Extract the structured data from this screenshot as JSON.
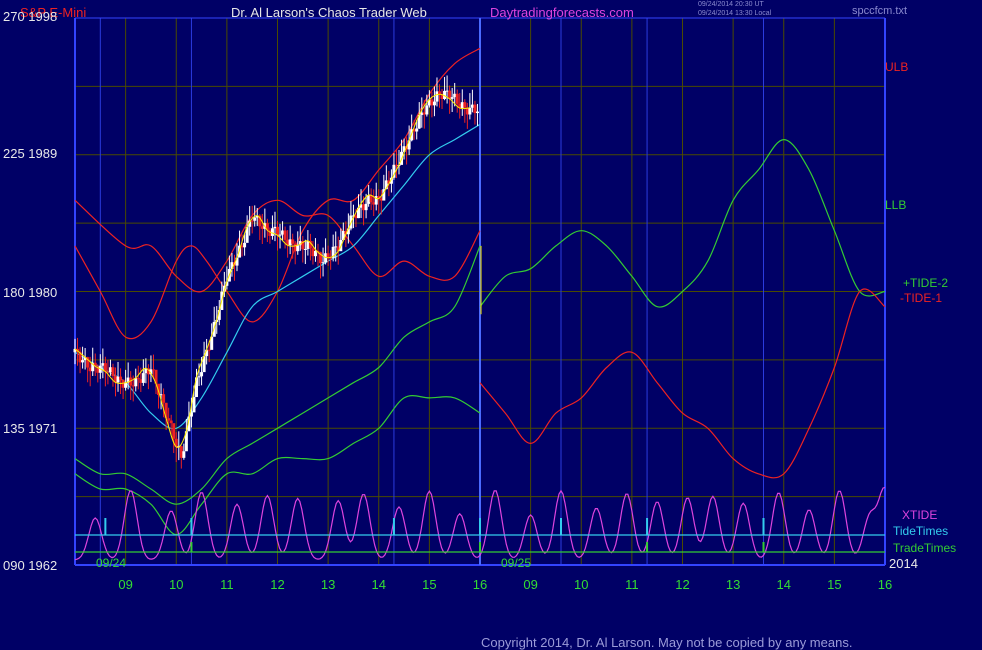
{
  "header": {
    "instrument": "S&P E-Mini",
    "site_title": "Dr. Al Larson's Chaos Trader Web",
    "url": "Daytradingforecasts.com",
    "update_line1": "09/24/2014 20:30 UT",
    "update_line2": "09/24/2014 13:30 Local",
    "filename": "spccfcm.txt"
  },
  "y_labels": [
    {
      "text": "270  1998"
    },
    {
      "text": "225  1989"
    },
    {
      "text": "180  1980"
    },
    {
      "text": "135  1971"
    },
    {
      "text": "090  1962"
    }
  ],
  "right_labels": {
    "ulb": "ULB",
    "llb": "LLB",
    "tide2": "+TIDE-2",
    "tide1": "-TIDE-1",
    "xtide": "XTIDE",
    "tidetimes": "TideTimes",
    "tradetimes": "TradeTimes",
    "year": "2014"
  },
  "date_labels": {
    "d1": "09/24",
    "d2": "09/25"
  },
  "x_hours": [
    "09",
    "10",
    "11",
    "12",
    "13",
    "14",
    "15",
    "16",
    "09",
    "10",
    "11",
    "12",
    "13",
    "14",
    "15",
    "16"
  ],
  "colors": {
    "background": "#000066",
    "frame": "#3344ff",
    "grid": "#4a4a00",
    "red": "#ee2222",
    "green": "#33cc33",
    "cyan": "#33ccee",
    "magenta": "#dd44dd",
    "white": "#ffffff",
    "yellow": "#ffee00"
  },
  "copyright": "Copyright 2014, Dr. Al Larson. May not be copied by any means.",
  "chart_data": {
    "type": "line",
    "title": "S&P E-Mini",
    "x_unit": "hour (two sessions, 09/24 and 09/25)",
    "ylim_price": [
      1962,
      1998
    ],
    "ylim_index": [
      90,
      270
    ],
    "series": [
      {
        "name": "ULB",
        "color": "red",
        "x": [
          8,
          8.5,
          9,
          9.5,
          10,
          10.3,
          10.6,
          11,
          11.5,
          12,
          12.5,
          13,
          13.5,
          14,
          14.5,
          15,
          15.5,
          16
        ],
        "y": [
          1983,
          1980,
          1977,
          1978,
          1982,
          1983,
          1982,
          1980,
          1978,
          1980,
          1984,
          1986,
          1986,
          1988,
          1990,
          1993,
          1995,
          1996
        ]
      },
      {
        "name": "Upper band",
        "color": "red",
        "x": [
          8,
          9,
          9.5,
          10,
          10.5,
          11,
          11.5,
          12,
          12.5,
          13,
          13.5,
          14,
          14.5,
          15,
          15.5,
          16
        ],
        "y": [
          1986,
          1983,
          1983,
          1981,
          1980,
          1982,
          1985,
          1986,
          1985,
          1985,
          1983,
          1981,
          1982,
          1981,
          1981,
          1984
        ]
      },
      {
        "name": "+TIDE-2",
        "color": "green",
        "x": [
          16,
          16.5,
          17,
          17.5,
          18,
          18.5,
          19,
          19.5,
          20,
          20.5,
          21,
          21.5,
          22,
          22.5,
          23,
          23.5,
          24
        ],
        "y": [
          1979,
          1981,
          1981.5,
          1983,
          1984,
          1983,
          1981,
          1979,
          1980,
          1982,
          1986,
          1988,
          1990,
          1988,
          1984,
          1980,
          1980
        ]
      },
      {
        "name": "-TIDE-1",
        "color": "red",
        "x": [
          16,
          16.5,
          17,
          17.5,
          18,
          18.5,
          19,
          19.5,
          20,
          20.5,
          21,
          21.5,
          22,
          22.5,
          23,
          23.5,
          24
        ],
        "y": [
          1974,
          1972,
          1970,
          1972,
          1973,
          1975,
          1976,
          1974,
          1972,
          1971,
          1969,
          1968,
          1968,
          1971,
          1975,
          1980,
          1979
        ]
      },
      {
        "name": "LLB",
        "color": "green",
        "x": [
          8,
          8.5,
          9,
          9.5,
          10,
          10.5,
          11,
          11.5,
          12,
          12.5,
          13,
          13.5,
          14,
          14.5,
          15,
          15.5,
          16
        ],
        "y": [
          1969,
          1968,
          1968,
          1967,
          1966,
          1967,
          1969,
          1970,
          1971,
          1972,
          1973,
          1974,
          1975,
          1977,
          1978,
          1979,
          1983
        ]
      },
      {
        "name": "Lower band",
        "color": "green",
        "x": [
          8,
          8.5,
          9,
          9.5,
          10,
          10.5,
          11,
          11.5,
          12,
          12.5,
          13,
          13.5,
          14,
          14.5,
          15,
          15.5,
          16
        ],
        "y": [
          1968,
          1967,
          1967,
          1966,
          1964,
          1966,
          1968,
          1968,
          1969,
          1969,
          1969,
          1970,
          1971,
          1973,
          1973,
          1973,
          1972
        ]
      },
      {
        "name": "Average",
        "color": "cyan",
        "x": [
          8,
          8.5,
          9,
          9.5,
          10,
          10.5,
          11,
          11.5,
          12,
          12.5,
          13,
          13.5,
          14,
          14.5,
          15,
          15.5,
          16
        ],
        "y": [
          1976,
          1975,
          1974,
          1972,
          1971,
          1973,
          1976,
          1979,
          1980,
          1981,
          1982,
          1983,
          1985,
          1987,
          1989,
          1990,
          1991
        ]
      },
      {
        "name": "Price",
        "color": "white",
        "x": [
          8,
          8.3,
          8.6,
          8.9,
          9.2,
          9.5,
          9.8,
          10.1,
          10.4,
          10.7,
          11,
          11.3,
          11.5,
          11.8,
          12,
          12.3,
          12.6,
          12.9,
          13.2,
          13.5,
          13.8,
          14,
          14.3,
          14.6,
          14.9,
          15.2,
          15.4,
          15.7,
          16
        ],
        "y": [
          1976,
          1975,
          1975,
          1974,
          1974,
          1975,
          1972,
          1969,
          1974,
          1977,
          1981,
          1983,
          1985,
          1984,
          1984,
          1983,
          1983,
          1982,
          1983,
          1985,
          1986,
          1986,
          1988,
          1990,
          1992,
          1993,
          1993,
          1992,
          1992
        ]
      }
    ],
    "xtide": {
      "name": "XTIDE",
      "color": "magenta",
      "peaks": [
        8.4,
        9.1,
        9.9,
        10.5,
        11.2,
        11.8,
        12.4,
        13.2,
        13.7,
        14.4,
        15.0,
        15.6,
        16.3,
        17.0,
        17.6,
        18.3,
        18.9,
        19.5,
        20.1,
        20.6,
        21.2,
        21.9,
        22.5,
        23.1,
        23.7,
        24.0
      ]
    },
    "tide_times": [
      8.6,
      10.3,
      14.3,
      16.0,
      17.6,
      19.3,
      21.6
    ],
    "trade_times": [
      10.3,
      16.0,
      19.3,
      21.6
    ]
  }
}
